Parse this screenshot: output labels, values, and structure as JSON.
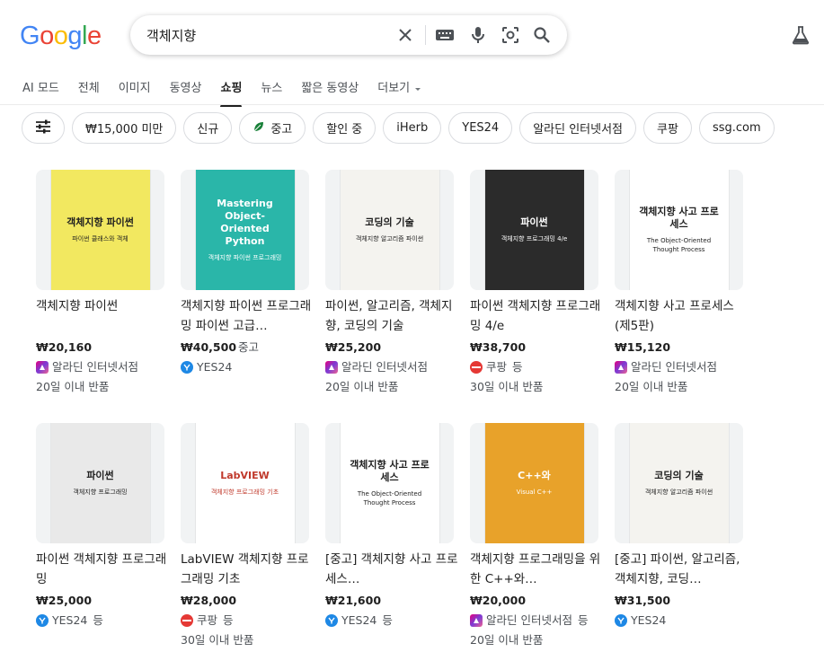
{
  "logo": {
    "letters": [
      "G",
      "o",
      "o",
      "g",
      "l",
      "e"
    ],
    "colors": [
      "#4285F4",
      "#EA4335",
      "#FBBC05",
      "#4285F4",
      "#34A853",
      "#EA4335"
    ]
  },
  "search": {
    "query": "객체지향"
  },
  "tabs": [
    "AI 모드",
    "전체",
    "이미지",
    "동영상",
    "쇼핑",
    "뉴스",
    "짧은 동영상",
    "더보기"
  ],
  "active_tab": "쇼핑",
  "chips": [
    "₩15,000 미만",
    "신규",
    "중고",
    "할인 중",
    "iHerb",
    "YES24",
    "알라딘 인터넷서점",
    "쿠팡",
    "ssg.com"
  ],
  "products": [
    {
      "title": "객체지향 파이썬",
      "price": "₩20,160",
      "condition": "",
      "seller": "알라딘 인터넷서점",
      "seller_icon": "aladin",
      "suffix": "",
      "returns": "20일 이내 반품",
      "cover": {
        "bg": "#f2e860",
        "fg": "#1f1f1f",
        "lines": [
          "객체지향 파이썬",
          "파이썬 클래스와 객체"
        ]
      }
    },
    {
      "title": "객체지향 파이썬 프로그래밍 파이썬 고급…",
      "price": "₩40,500",
      "condition": "중고",
      "seller": "YES24",
      "seller_icon": "yes24",
      "suffix": "",
      "returns": "",
      "cover": {
        "bg": "#2ab6a9",
        "fg": "#ffffff",
        "lines": [
          "Mastering Object-Oriented Python",
          "객체지향 파이썬 프로그래밍"
        ]
      }
    },
    {
      "title": "파이썬, 알고리즘, 객체지향, 코딩의 기술",
      "price": "₩25,200",
      "condition": "",
      "seller": "알라딘 인터넷서점",
      "seller_icon": "aladin",
      "suffix": "",
      "returns": "20일 이내 반품",
      "cover": {
        "bg": "#f4f3ef",
        "fg": "#1f1f1f",
        "lines": [
          "코딩의 기술",
          "객체지향 알고리즘 파이썬"
        ]
      }
    },
    {
      "title": "파이썬 객체지향 프로그래밍 4/e",
      "price": "₩38,700",
      "condition": "",
      "seller": "쿠팡",
      "seller_icon": "coupang",
      "suffix": "등",
      "returns": "30일 이내 반품",
      "cover": {
        "bg": "#2b2b2b",
        "fg": "#ffffff",
        "lines": [
          "파이썬",
          "객체지향 프로그래밍 4/e"
        ]
      }
    },
    {
      "title": "객체지향 사고 프로세스(제5판)",
      "price": "₩15,120",
      "condition": "",
      "seller": "알라딘 인터넷서점",
      "seller_icon": "aladin",
      "suffix": "",
      "returns": "20일 이내 반품",
      "cover": {
        "bg": "#ffffff",
        "fg": "#1f1f1f",
        "lines": [
          "객체지향 사고 프로세스",
          "The Object-Oriented Thought Process"
        ]
      }
    },
    {
      "title": "파이썬 객체지향 프로그래밍",
      "price": "₩25,000",
      "condition": "",
      "seller": "YES24",
      "seller_icon": "yes24",
      "suffix": "등",
      "returns": "",
      "cover": {
        "bg": "#e9e9e9",
        "fg": "#1f1f1f",
        "lines": [
          "파이썬",
          "객체지향 프로그래밍"
        ]
      }
    },
    {
      "title": "LabVIEW 객체지향 프로그래밍 기초",
      "price": "₩28,000",
      "condition": "",
      "seller": "쿠팡",
      "seller_icon": "coupang",
      "suffix": "등",
      "returns": "30일 이내 반품",
      "cover": {
        "bg": "#ffffff",
        "fg": "#c0392b",
        "lines": [
          "LabVIEW",
          "객체지향 프로그래밍 기초"
        ]
      }
    },
    {
      "title": "[중고] 객체지향 사고 프로세스…",
      "price": "₩21,600",
      "condition": "",
      "seller": "YES24",
      "seller_icon": "yes24",
      "suffix": "등",
      "returns": "",
      "cover": {
        "bg": "#ffffff",
        "fg": "#1f1f1f",
        "lines": [
          "객체지향 사고 프로세스",
          "The Object-Oriented Thought Process"
        ]
      }
    },
    {
      "title": "객체지향 프로그래밍을 위한 C++와…",
      "price": "₩20,000",
      "condition": "",
      "seller": "알라딘 인터넷서점",
      "seller_icon": "aladin",
      "suffix": "등",
      "returns": "20일 이내 반품",
      "cover": {
        "bg": "#e8a22a",
        "fg": "#ffffff",
        "lines": [
          "C++와",
          "Visual C++"
        ]
      }
    },
    {
      "title": "[중고] 파이썬, 알고리즘, 객체지향, 코딩…",
      "price": "₩31,500",
      "condition": "",
      "seller": "YES24",
      "seller_icon": "yes24",
      "suffix": "",
      "returns": "",
      "cover": {
        "bg": "#f4f3ef",
        "fg": "#1f1f1f",
        "lines": [
          "코딩의 기술",
          "객체지향 알고리즘 파이썬"
        ]
      }
    }
  ]
}
